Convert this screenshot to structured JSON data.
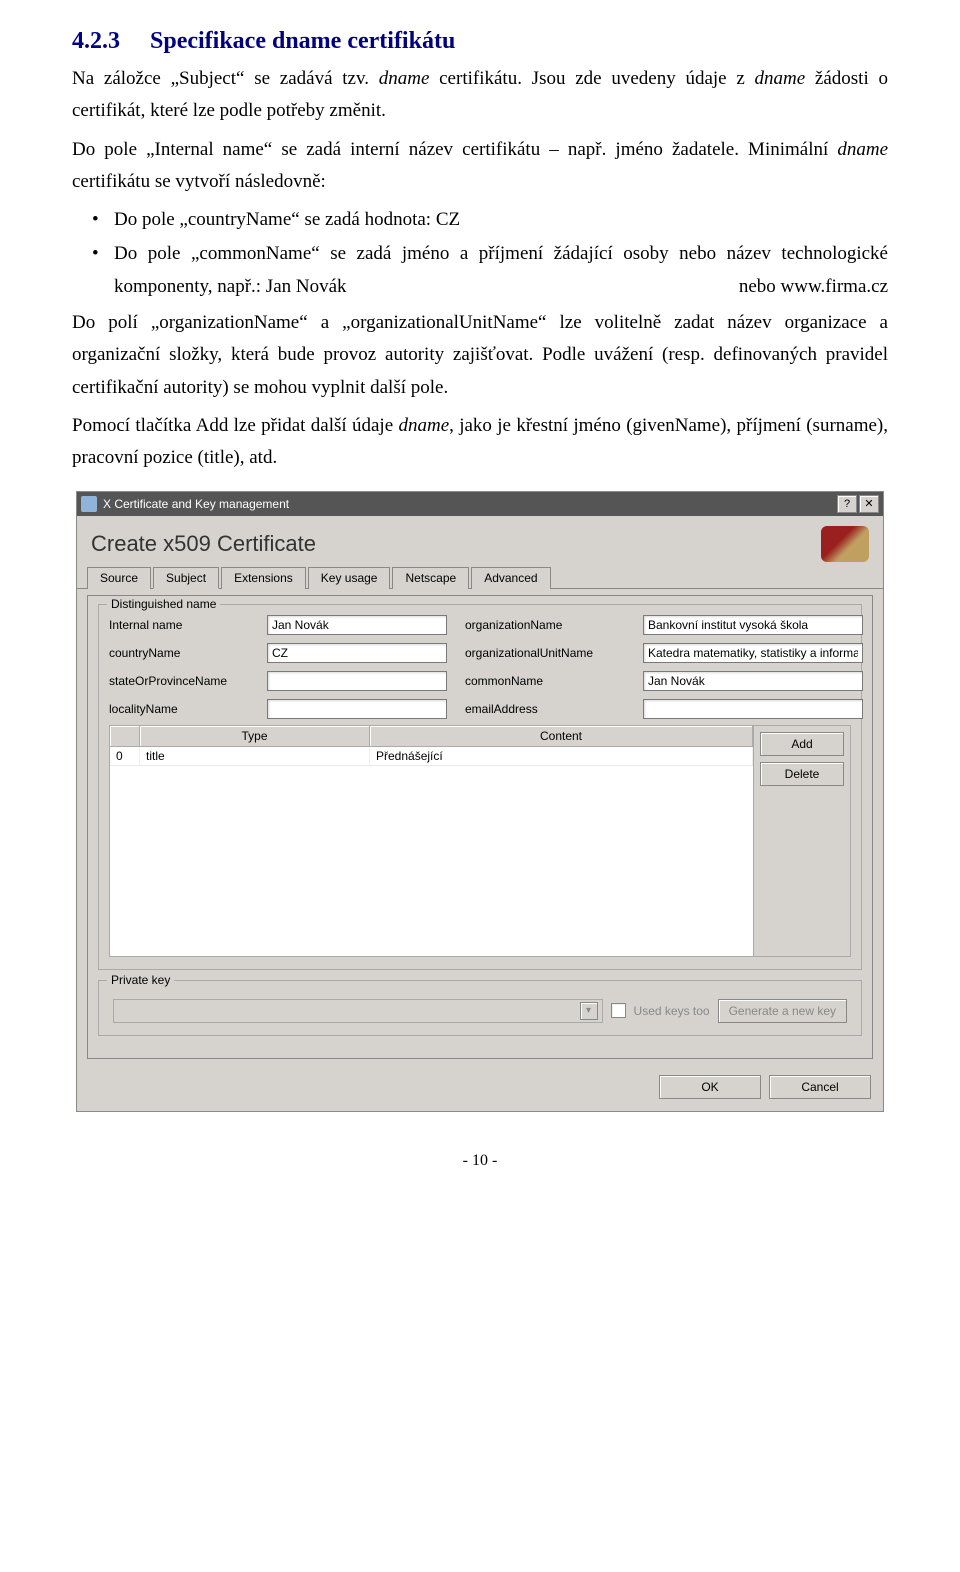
{
  "doc": {
    "heading_number": "4.2.3",
    "heading_text": "Specifikace dname certifikátu",
    "p1a": "Na záložce „Subject“ se zadává tzv. ",
    "p1b": "dname",
    "p1c": " certifikátu. Jsou zde uvedeny údaje z ",
    "p1d": "dname",
    "p1e": " žádosti o certifikát, které lze podle potřeby změnit.",
    "p2": "Do pole „Internal name“ se zadá interní název certifikátu – např. jméno žadatele. Minimální ",
    "p2b": "dname",
    "p2c": " certifikátu se vytvoří následovně:",
    "bullet1": "Do pole „countryName“ se zadá hodnota: CZ",
    "bullet2a": "Do pole „commonName“ se zadá jméno a příjmení žádající osoby nebo název technologické komponenty, např.: Jan Novák",
    "bullet2b": "nebo   www.firma.cz",
    "p3": "Do polí „organizationName“ a „organizationalUnitName“ lze volitelně zadat název organizace a organizační složky, která bude provoz autority zajišťovat. Podle uvážení (resp. definovaných pravidel certifikační autority) se mohou vyplnit další pole.",
    "p4a": "Pomocí tlačítka Add lze přidat další údaje ",
    "p4b": "dname",
    "p4c": ", jako je křestní jméno (givenName), příjmení (surname), pracovní pozice (title), atd."
  },
  "win": {
    "title": "X Certificate and Key management",
    "dialog_title": "Create x509 Certificate",
    "tabs": [
      "Source",
      "Subject",
      "Extensions",
      "Key usage",
      "Netscape",
      "Advanced"
    ],
    "active_tab_index": 1,
    "fieldset_legend": "Distinguished name",
    "labels": {
      "internalName": "Internal name",
      "countryName": "countryName",
      "stateOrProvinceName": "stateOrProvinceName",
      "localityName": "localityName",
      "organizationName": "organizationName",
      "organizationalUnitName": "organizationalUnitName",
      "commonName": "commonName",
      "emailAddress": "emailAddress"
    },
    "values": {
      "internalName": "Jan Novák",
      "countryName": "CZ",
      "stateOrProvinceName": "",
      "localityName": "",
      "organizationName": "Bankovní institut vysoká škola",
      "organizationalUnitName": "Katedra matematiky, statistiky a informači",
      "commonName": "Jan Novák",
      "emailAddress": ""
    },
    "table": {
      "headers": [
        "",
        "Type",
        "Content"
      ],
      "rows": [
        {
          "idx": "0",
          "type": "title",
          "content": "Přednášející"
        }
      ],
      "add_label": "Add",
      "delete_label": "Delete"
    },
    "private_key_legend": "Private key",
    "used_keys_label": "Used keys too",
    "gen_key_label": "Generate a new key",
    "ok_label": "OK",
    "cancel_label": "Cancel",
    "help_glyph": "?",
    "close_glyph": "✕"
  },
  "pageno": "- 10 -"
}
